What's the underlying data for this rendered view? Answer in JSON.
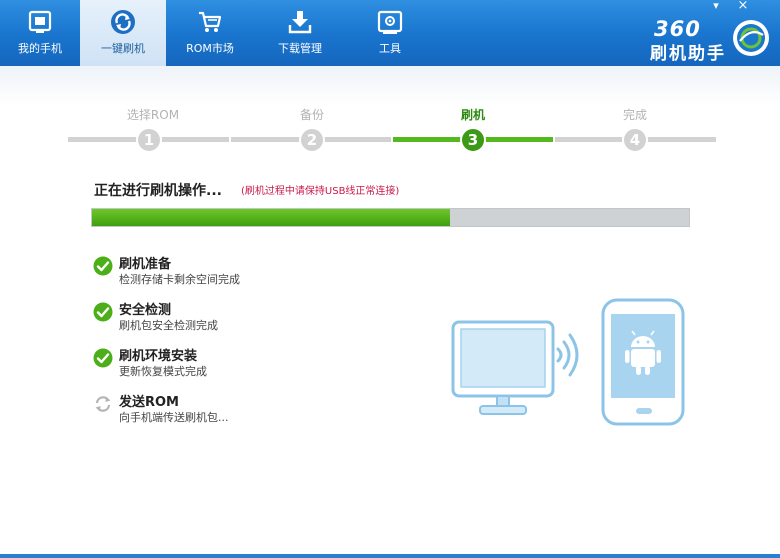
{
  "nav": [
    {
      "label": "我的手机",
      "icon": "phone-screen-icon",
      "active": false
    },
    {
      "label": "一键刷机",
      "icon": "flash-refresh-icon",
      "active": true
    },
    {
      "label": "ROM市场",
      "icon": "cart-icon",
      "active": false
    },
    {
      "label": "下载管理",
      "icon": "download-icon",
      "active": false
    },
    {
      "label": "工具",
      "icon": "toolbox-icon",
      "active": false
    }
  ],
  "window_controls": {
    "menu": "▾",
    "close": "×"
  },
  "brand": {
    "number": "360",
    "name": "刷机助手"
  },
  "steps": [
    {
      "label": "选择ROM",
      "number": "1",
      "state": "pending"
    },
    {
      "label": "备份",
      "number": "2",
      "state": "pending"
    },
    {
      "label": "刷机",
      "number": "3",
      "state": "active"
    },
    {
      "label": "完成",
      "number": "4",
      "state": "pending"
    }
  ],
  "operation": {
    "title": "正在进行刷机操作...",
    "note": "(刷机过程中请保持USB线正常连接)"
  },
  "progress": {
    "percent": 60
  },
  "tasks": [
    {
      "title": "刷机准备",
      "desc": "检测存储卡剩余空间完成",
      "status": "done"
    },
    {
      "title": "安全检测",
      "desc": "刷机包安全检测完成",
      "status": "done"
    },
    {
      "title": "刷机环境安装",
      "desc": "更新恢复模式完成",
      "status": "done"
    },
    {
      "title": "发送ROM",
      "desc": "向手机端传送刷机包...",
      "status": "in-progress"
    }
  ],
  "colors": {
    "topbar": "#1a76cf",
    "accent_green": "#55b81c",
    "step_active": "#3d9a16",
    "note_red": "#c9184a",
    "illustration_blue": "#8cc4e8"
  }
}
